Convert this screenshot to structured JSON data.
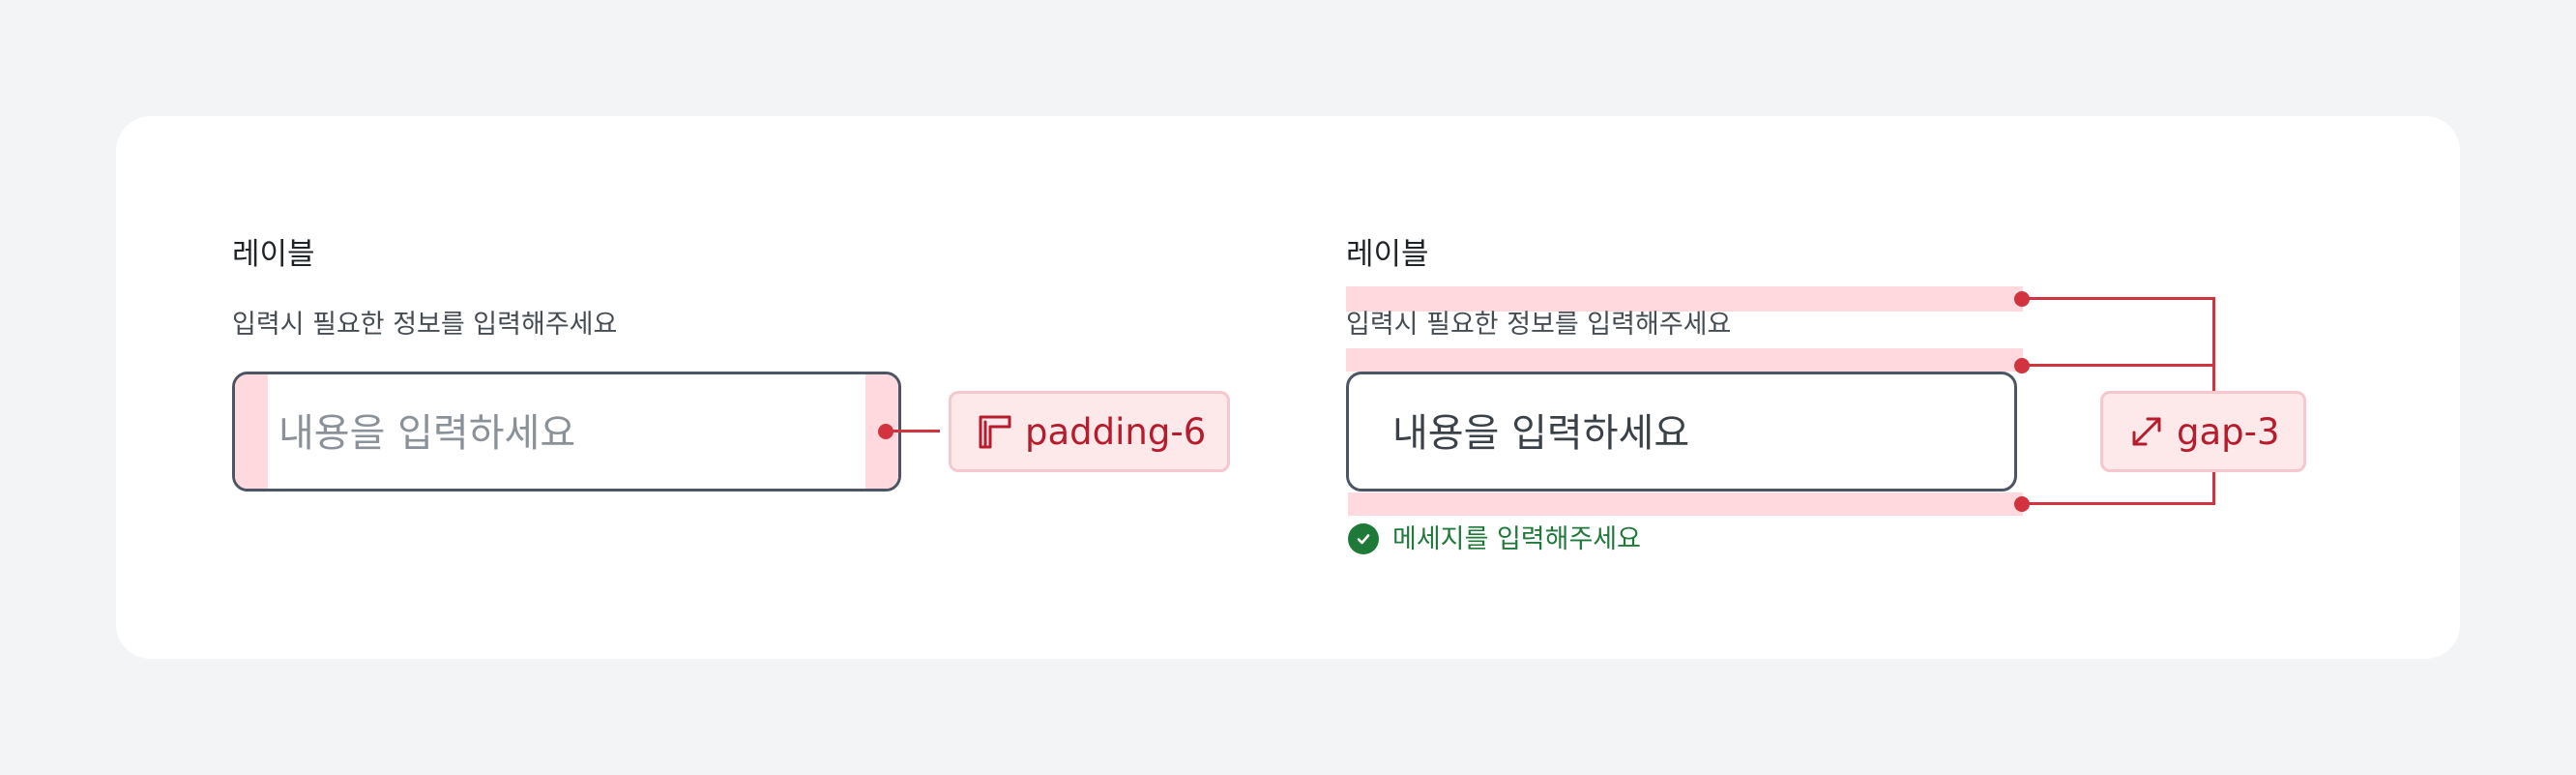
{
  "left_example": {
    "label": "레이블",
    "help_text": "입력시 필요한 정보를 입력해주세요",
    "placeholder": "내용을 입력하세요",
    "annotation": {
      "icon": "padding-icon",
      "text": "padding-6"
    }
  },
  "right_example": {
    "label": "레이블",
    "help_text": "입력시 필요한 정보를 입력해주세요",
    "value": "내용을 입력하세요",
    "message": {
      "icon": "check-circle-icon",
      "text": "메세지를 입력해주세요"
    },
    "annotation": {
      "icon": "expand-arrows-icon",
      "text": "gap-3"
    }
  },
  "colors": {
    "page_background": "#f3f4f6",
    "card_background": "#ffffff",
    "highlight": "#ffd9de",
    "annotation_line": "#d1343f",
    "annotation_text": "#b71c2c",
    "success": "#1f7a3a",
    "placeholder": "#8a9199",
    "value": "#3a4148"
  }
}
